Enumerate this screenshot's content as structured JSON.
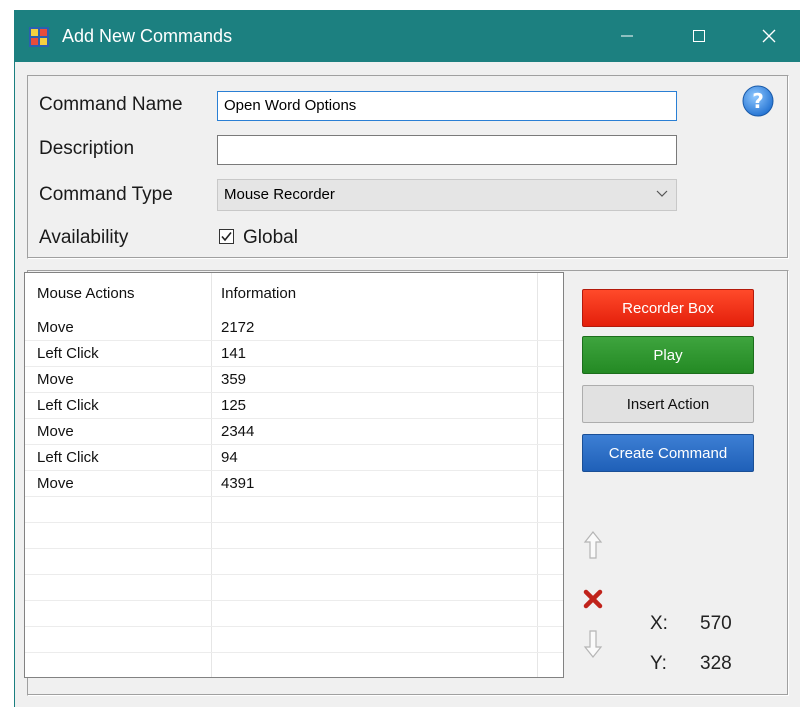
{
  "window": {
    "title": "Add New Commands"
  },
  "form": {
    "command_name_label": "Command Name",
    "command_name_value": "Open Word Options",
    "description_label": "Description",
    "description_value": "",
    "command_type_label": "Command Type",
    "command_type_value": "Mouse Recorder",
    "availability_label": "Availability",
    "global_label": "Global",
    "global_checked": true
  },
  "list": {
    "columns": [
      "Mouse Actions",
      "Information"
    ],
    "rows": [
      [
        "Move",
        "2172"
      ],
      [
        "Left Click",
        "141"
      ],
      [
        "Move",
        "359"
      ],
      [
        "Left Click",
        "125"
      ],
      [
        "Move",
        "2344"
      ],
      [
        "Left Click",
        "94"
      ],
      [
        "Move",
        "4391"
      ]
    ]
  },
  "buttons": {
    "recorder_box": "Recorder Box",
    "play": "Play",
    "insert_action": "Insert Action",
    "create_command": "Create Command"
  },
  "coords": {
    "x_label": "X:",
    "x_value": "570",
    "y_label": "Y:",
    "y_value": "328"
  },
  "colors": {
    "titlebar": "#1c8080",
    "recorder": "#ff3c1e",
    "play": "#2f962f",
    "create": "#2a6fc8"
  },
  "icons": [
    "app-icon",
    "minimize-icon",
    "maximize-icon",
    "close-icon",
    "help-icon",
    "move-up-icon",
    "delete-icon",
    "move-down-icon"
  ]
}
